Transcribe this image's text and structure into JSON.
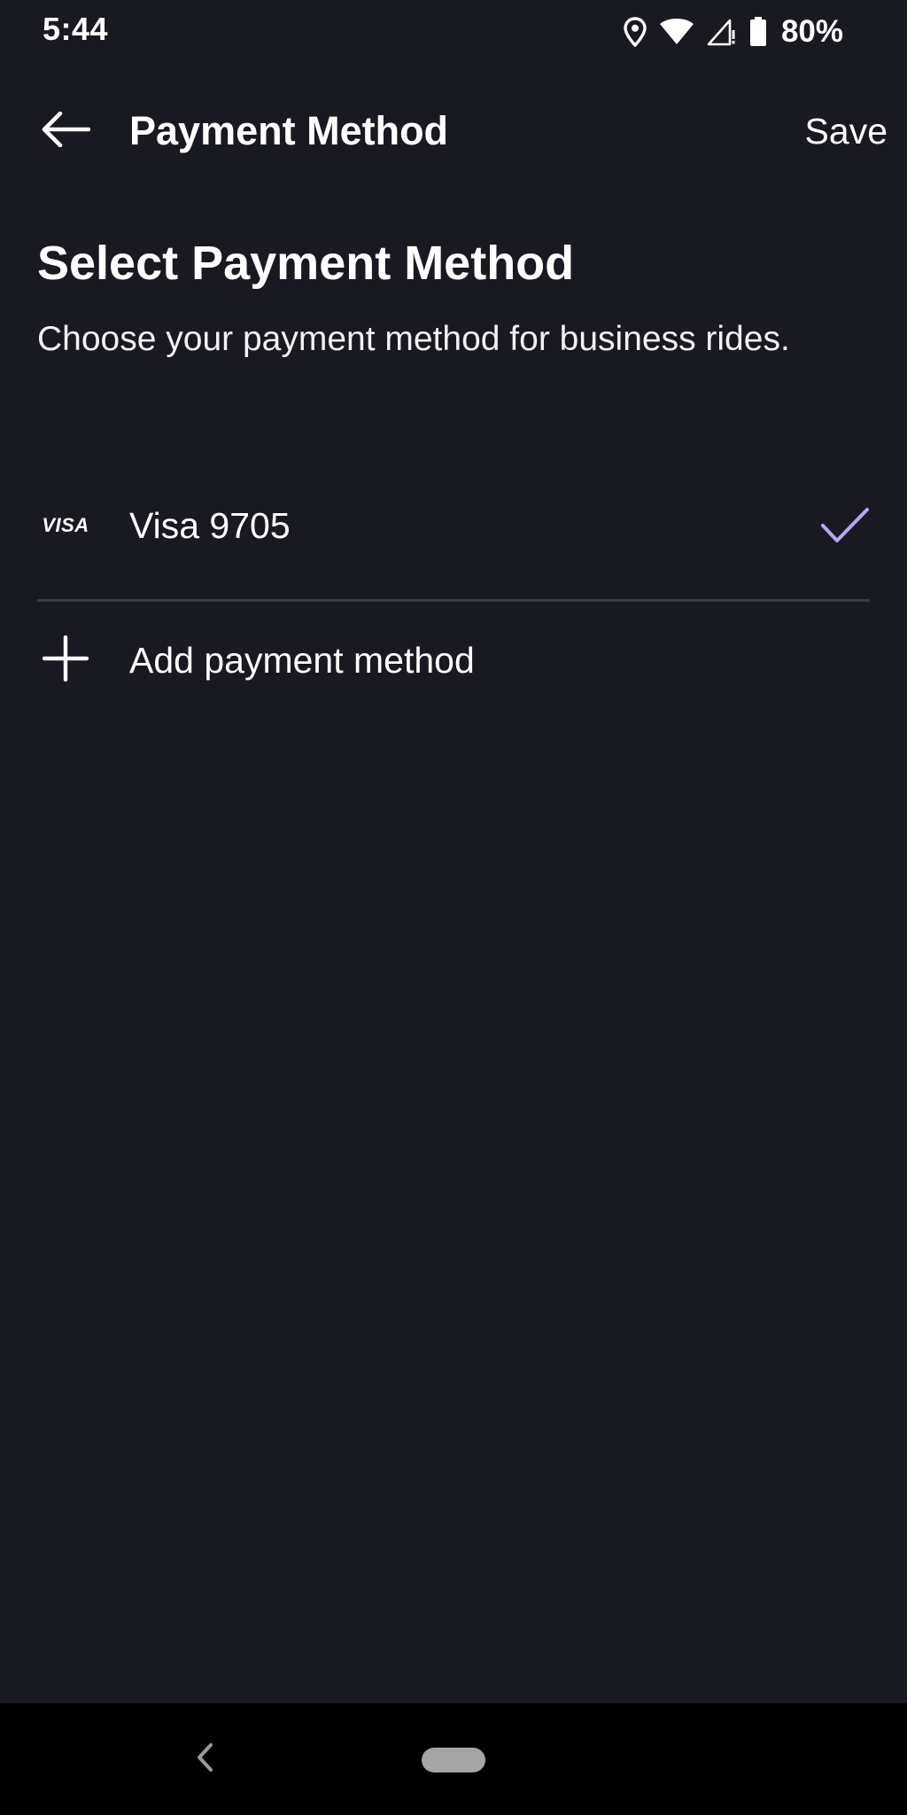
{
  "status_bar": {
    "time": "5:44",
    "battery": "80%",
    "icons": [
      "location-icon",
      "wifi-icon",
      "signal-icon",
      "battery-icon"
    ]
  },
  "toolbar": {
    "title": "Payment Method",
    "save_label": "Save",
    "back_icon": "arrow-left-icon"
  },
  "main": {
    "title": "Select Payment Method",
    "description": "Choose your payment method for business rides.",
    "payment_methods": [
      {
        "brand": "VISA",
        "label": "Visa 9705",
        "selected": true
      }
    ],
    "add_label": "Add payment method"
  },
  "colors": {
    "background": "#191a21",
    "text": "#ffffff",
    "accent_check": "#b8a6f2",
    "divider": "#3a3b44",
    "nav_bar": "#000000"
  }
}
